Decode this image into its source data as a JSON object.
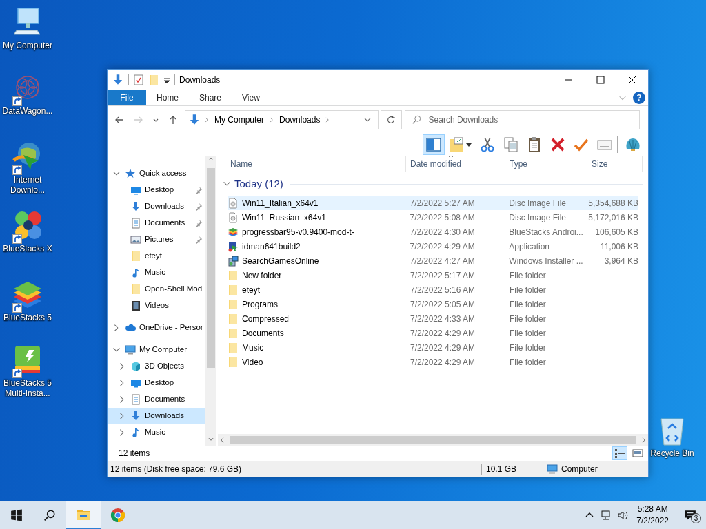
{
  "desktop_icons": [
    {
      "label": "My Computer",
      "kind": "computer",
      "shortcut": false
    },
    {
      "label": "DataWagon...",
      "kind": "network",
      "shortcut": true
    },
    {
      "label": "Internet Downlo...",
      "kind": "globe",
      "shortcut": true
    },
    {
      "label": "BlueStacks X",
      "kind": "bsx",
      "shortcut": true
    },
    {
      "label": "BlueStacks 5",
      "kind": "layers",
      "shortcut": true
    },
    {
      "label": "BlueStacks 5 Multi-Insta...",
      "kind": "multi",
      "shortcut": true
    }
  ],
  "recycle_bin": {
    "label": "Recycle Bin"
  },
  "window": {
    "title": "Downloads",
    "ribbon_tabs": [
      {
        "label": "File",
        "selected": true
      },
      {
        "label": "Home",
        "selected": false
      },
      {
        "label": "Share",
        "selected": false
      },
      {
        "label": "View",
        "selected": false
      }
    ],
    "help": "?",
    "address": [
      "My Computer",
      "Downloads"
    ],
    "search": {
      "placeholder": "Search Downloads"
    },
    "preview_pane_on": true,
    "toolbar": [
      {
        "kind": "pane"
      },
      {
        "kind": "moveto"
      },
      {
        "kind": "cut"
      },
      {
        "kind": "copy"
      },
      {
        "kind": "paste"
      },
      {
        "kind": "delete"
      },
      {
        "kind": "check"
      },
      {
        "kind": "mail"
      },
      {
        "kind": "shell"
      }
    ],
    "nav": [
      {
        "label": "Quick access",
        "kind": "star",
        "expanded": true,
        "selected": false,
        "children": [
          {
            "label": "Desktop",
            "kind": "desktop",
            "pinned": true,
            "selected": false
          },
          {
            "label": "Downloads",
            "kind": "download",
            "pinned": true,
            "selected": false
          },
          {
            "label": "Documents",
            "kind": "document",
            "pinned": true,
            "selected": false
          },
          {
            "label": "Pictures",
            "kind": "picture",
            "pinned": true,
            "selected": false
          },
          {
            "label": "eteyt",
            "kind": "folder",
            "pinned": false,
            "selected": false
          },
          {
            "label": "Music",
            "kind": "music",
            "pinned": false,
            "selected": false
          },
          {
            "label": "Open-Shell Mod",
            "kind": "folder",
            "pinned": false,
            "selected": false
          },
          {
            "label": "Videos",
            "kind": "video",
            "pinned": false,
            "selected": false
          }
        ]
      },
      {
        "label": "OneDrive - Persor",
        "kind": "cloud",
        "expanded": false,
        "selected": false
      },
      {
        "label": "My Computer",
        "kind": "computer",
        "expanded": true,
        "selected": false,
        "children": [
          {
            "label": "3D Objects",
            "kind": "cube",
            "expanded": false,
            "selected": false
          },
          {
            "label": "Desktop",
            "kind": "desktop",
            "expanded": false,
            "selected": false
          },
          {
            "label": "Documents",
            "kind": "document",
            "expanded": false,
            "selected": false
          },
          {
            "label": "Downloads",
            "kind": "download",
            "expanded": false,
            "selected": true
          },
          {
            "label": "Music",
            "kind": "music",
            "expanded": false,
            "selected": false
          }
        ]
      }
    ],
    "columns": [
      "Name",
      "Date modified",
      "Type",
      "Size"
    ],
    "group": {
      "label": "Today (12)",
      "expanded": true
    },
    "files": [
      {
        "name": "Win11_Italian_x64v1",
        "date": "7/2/2022 5:27 AM",
        "type": "Disc Image File",
        "size": "5,354,688 KB",
        "kind": "disc",
        "selected": true
      },
      {
        "name": "Win11_Russian_x64v1",
        "date": "7/2/2022 5:08 AM",
        "type": "Disc Image File",
        "size": "5,172,016 KB",
        "kind": "disc",
        "selected": false
      },
      {
        "name": "progressbar95-v0.9400-mod-t-",
        "date": "7/2/2022 4:30 AM",
        "type": "BlueStacks Androi...",
        "size": "106,605 KB",
        "kind": "layers",
        "selected": false
      },
      {
        "name": "idman641build2",
        "date": "7/2/2022 4:29 AM",
        "type": "Application",
        "size": "11,006 KB",
        "kind": "app",
        "selected": false
      },
      {
        "name": "SearchGamesOnline",
        "date": "7/2/2022 4:27 AM",
        "type": "Windows Installer ...",
        "size": "3,964 KB",
        "kind": "installer",
        "selected": false
      },
      {
        "name": "New folder",
        "date": "7/2/2022 5:17 AM",
        "type": "File folder",
        "kind": "folder",
        "selected": false
      },
      {
        "name": "eteyt",
        "date": "7/2/2022 5:16 AM",
        "type": "File folder",
        "kind": "folder",
        "selected": false
      },
      {
        "name": "Programs",
        "date": "7/2/2022 5:05 AM",
        "type": "File folder",
        "kind": "folder",
        "selected": false
      },
      {
        "name": "Compressed",
        "date": "7/2/2022 4:33 AM",
        "type": "File folder",
        "kind": "folder",
        "selected": false
      },
      {
        "name": "Documents",
        "date": "7/2/2022 4:29 AM",
        "type": "File folder",
        "kind": "folder",
        "selected": false
      },
      {
        "name": "Music",
        "date": "7/2/2022 4:29 AM",
        "type": "File folder",
        "kind": "folder",
        "selected": false
      },
      {
        "name": "Video",
        "date": "7/2/2022 4:29 AM",
        "type": "File folder",
        "kind": "folder",
        "selected": false
      }
    ],
    "item_count": "12 items",
    "view_buttons": [
      {
        "kind": "details",
        "selected": true
      },
      {
        "kind": "tiles",
        "selected": false
      }
    ],
    "status_bar": {
      "text": "12 items (Disk free space: 79.6 GB)",
      "size": "10.1 GB",
      "location": "Computer"
    }
  },
  "taskbar": {
    "apps": [
      {
        "kind": "explorer",
        "selected": true
      },
      {
        "kind": "chrome",
        "selected": false
      }
    ],
    "time": "5:28 AM",
    "date": "7/2/2022",
    "notifications": "3"
  }
}
